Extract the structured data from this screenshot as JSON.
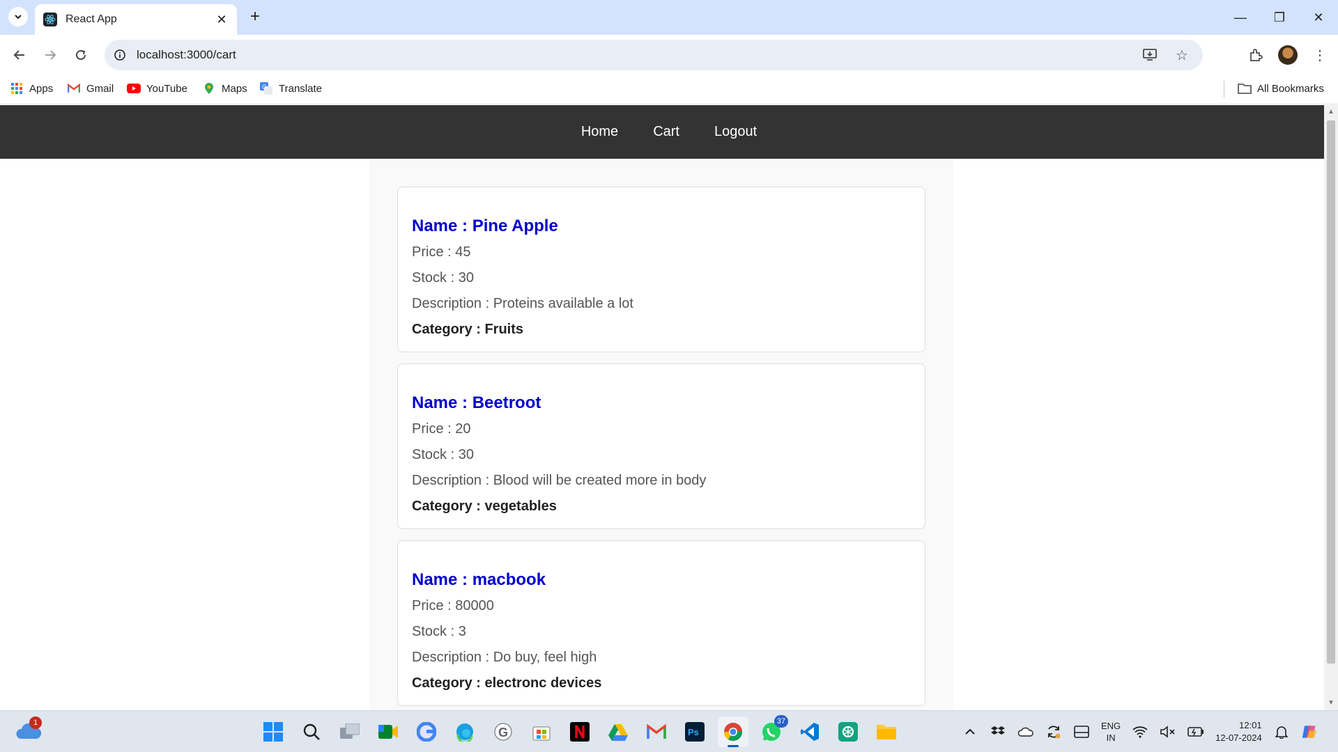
{
  "browser": {
    "tab_title": "React App",
    "url": "localhost:3000/cart",
    "bookmarks": [
      {
        "label": "Apps",
        "icon": "apps-grid-icon"
      },
      {
        "label": "Gmail",
        "icon": "gmail-icon"
      },
      {
        "label": "YouTube",
        "icon": "youtube-icon"
      },
      {
        "label": "Maps",
        "icon": "maps-icon"
      },
      {
        "label": "Translate",
        "icon": "translate-icon"
      }
    ],
    "all_bookmarks_label": "All Bookmarks"
  },
  "nav": {
    "links": [
      "Home",
      "Cart",
      "Logout"
    ]
  },
  "cart": {
    "items": [
      {
        "name": "Name : Pine Apple",
        "price": "Price : 45",
        "stock": "Stock : 30",
        "description": "Description : Proteins available a lot",
        "category": "Category : Fruits"
      },
      {
        "name": "Name : Beetroot",
        "price": "Price : 20",
        "stock": "Stock : 30",
        "description": "Description : Blood will be created more in body",
        "category": "Category : vegetables"
      },
      {
        "name": "Name : macbook",
        "price": "Price : 80000",
        "stock": "Stock : 3",
        "description": "Description : Do buy, feel high",
        "category": "Category : electronc devices"
      }
    ]
  },
  "taskbar": {
    "weather_badge": "1",
    "whatsapp_badge": "37",
    "lang_top": "ENG",
    "lang_bottom": "IN",
    "time": "12:01",
    "date": "12-07-2024"
  },
  "colors": {
    "navbar_bg": "#333333",
    "item_name": "#0000cd",
    "tabstrip_bg": "#d3e3fd"
  }
}
